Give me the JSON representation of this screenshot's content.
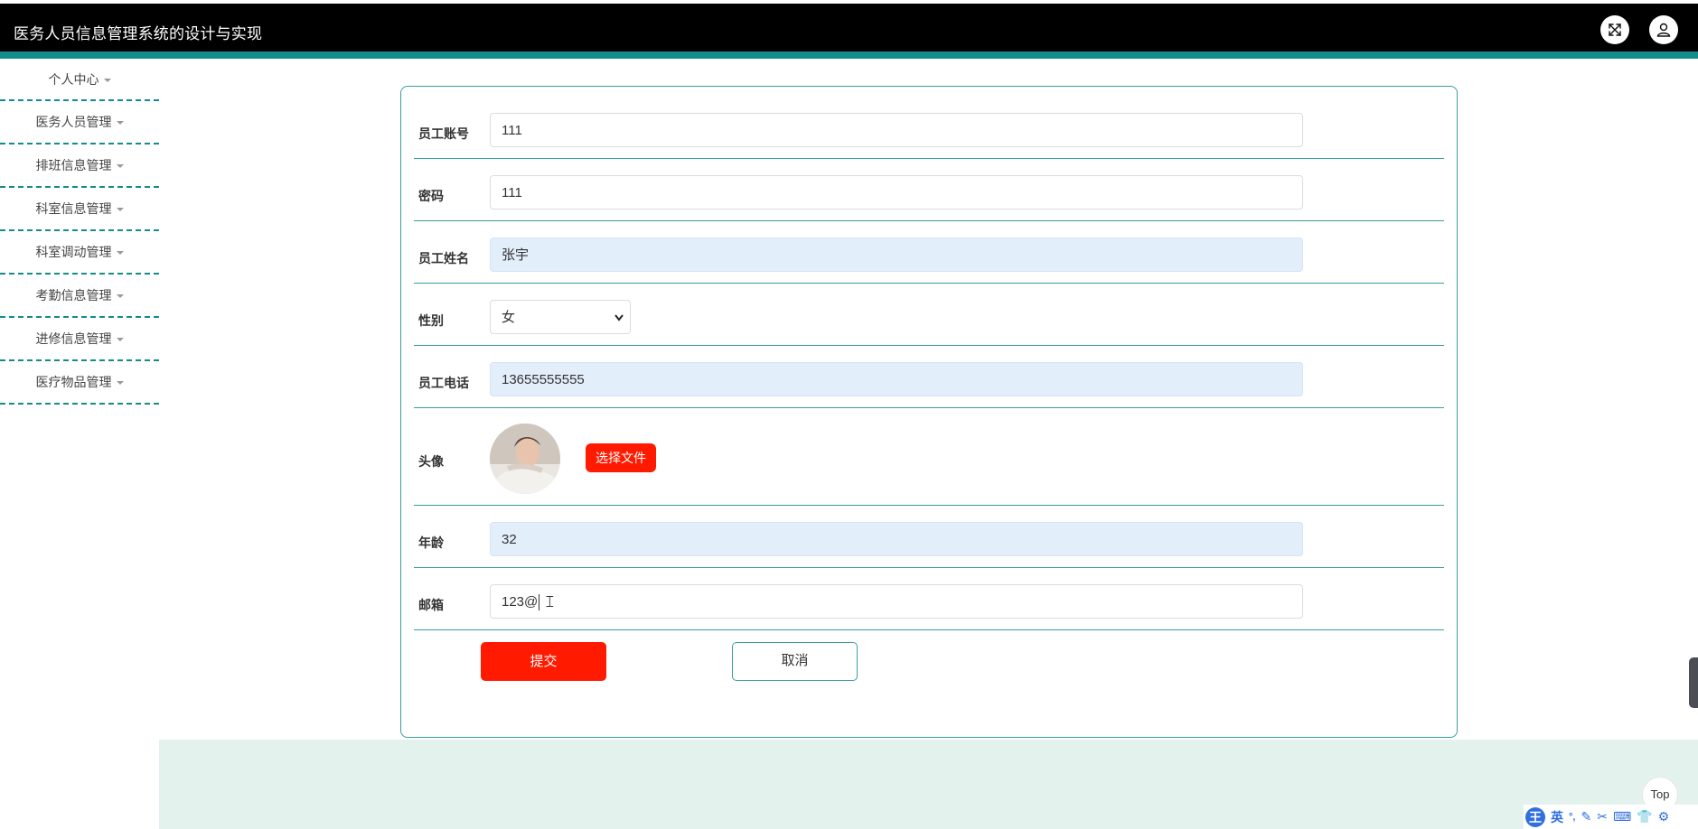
{
  "header": {
    "title": "医务人员信息管理系统的设计与实现",
    "fullscreen_icon": "expand-icon",
    "user_icon": "user-icon"
  },
  "sidebar": {
    "items": [
      {
        "label": "个人中心"
      },
      {
        "label": "医务人员管理"
      },
      {
        "label": "排班信息管理"
      },
      {
        "label": "科室信息管理"
      },
      {
        "label": "科室调动管理"
      },
      {
        "label": "考勤信息管理"
      },
      {
        "label": "进修信息管理"
      },
      {
        "label": "医疗物品管理"
      }
    ]
  },
  "form": {
    "account": {
      "label": "员工账号",
      "value": "111"
    },
    "password": {
      "label": "密码",
      "value": "111"
    },
    "name": {
      "label": "员工姓名",
      "value": "张宇"
    },
    "gender": {
      "label": "性别",
      "value": "女"
    },
    "phone": {
      "label": "员工电话",
      "value": "13655555555"
    },
    "avatar": {
      "label": "头像",
      "button": "选择文件"
    },
    "age": {
      "label": "年龄",
      "value": "32"
    },
    "email": {
      "label": "邮箱",
      "value": "123@"
    },
    "submit_label": "提交",
    "cancel_label": "取消"
  },
  "floating": {
    "top_label": "Top"
  },
  "ime": {
    "logo": "王",
    "mode": "英"
  },
  "colors": {
    "header_bg": "#000000",
    "accent_teal": "#128c8c",
    "primary_red": "#ff1a00",
    "filled_input_bg": "#e3eefb",
    "content_bg": "#e4f2ed"
  }
}
